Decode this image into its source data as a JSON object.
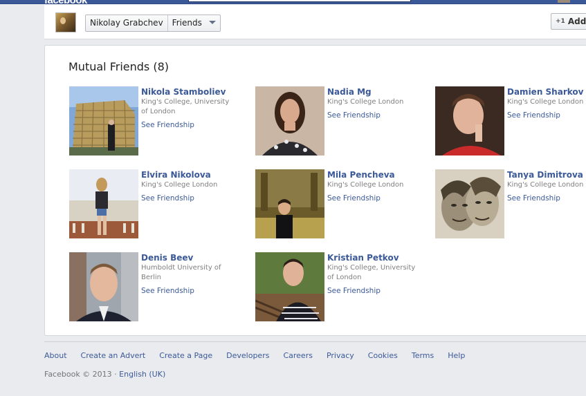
{
  "topbar": {
    "logo": "facebook"
  },
  "header": {
    "profile_name": "Nikolay Grabchev",
    "relationship": "Friends",
    "add_label": "Add"
  },
  "mutual": {
    "title": "Mutual Friends (8)",
    "see_friendship": "See Friendship",
    "friends": [
      {
        "name": "Nikola Stamboliev",
        "school": "King's College, University of London"
      },
      {
        "name": "Nadia Mg",
        "school": "King's College London"
      },
      {
        "name": "Damien Sharkov",
        "school": "King's College London"
      },
      {
        "name": "Elvira Nikolova",
        "school": "King's College London"
      },
      {
        "name": "Mila Pencheva",
        "school": "King's College London"
      },
      {
        "name": "Tanya Dimitrova",
        "school": "King's College London"
      },
      {
        "name": "Denis Beev",
        "school": "Humboldt University of Berlin"
      },
      {
        "name": "Kristian Petkov",
        "school": "King's College, University of London"
      }
    ]
  },
  "footer": {
    "links": [
      "About",
      "Create an Advert",
      "Create a Page",
      "Developers",
      "Careers",
      "Privacy",
      "Cookies",
      "Terms",
      "Help"
    ],
    "copyright": "Facebook © 2013 · ",
    "language": "English (UK)"
  },
  "colors": {
    "brand_blue": "#3b5998",
    "link_blue": "#3b5998",
    "muted_text": "#7f7f7f"
  }
}
